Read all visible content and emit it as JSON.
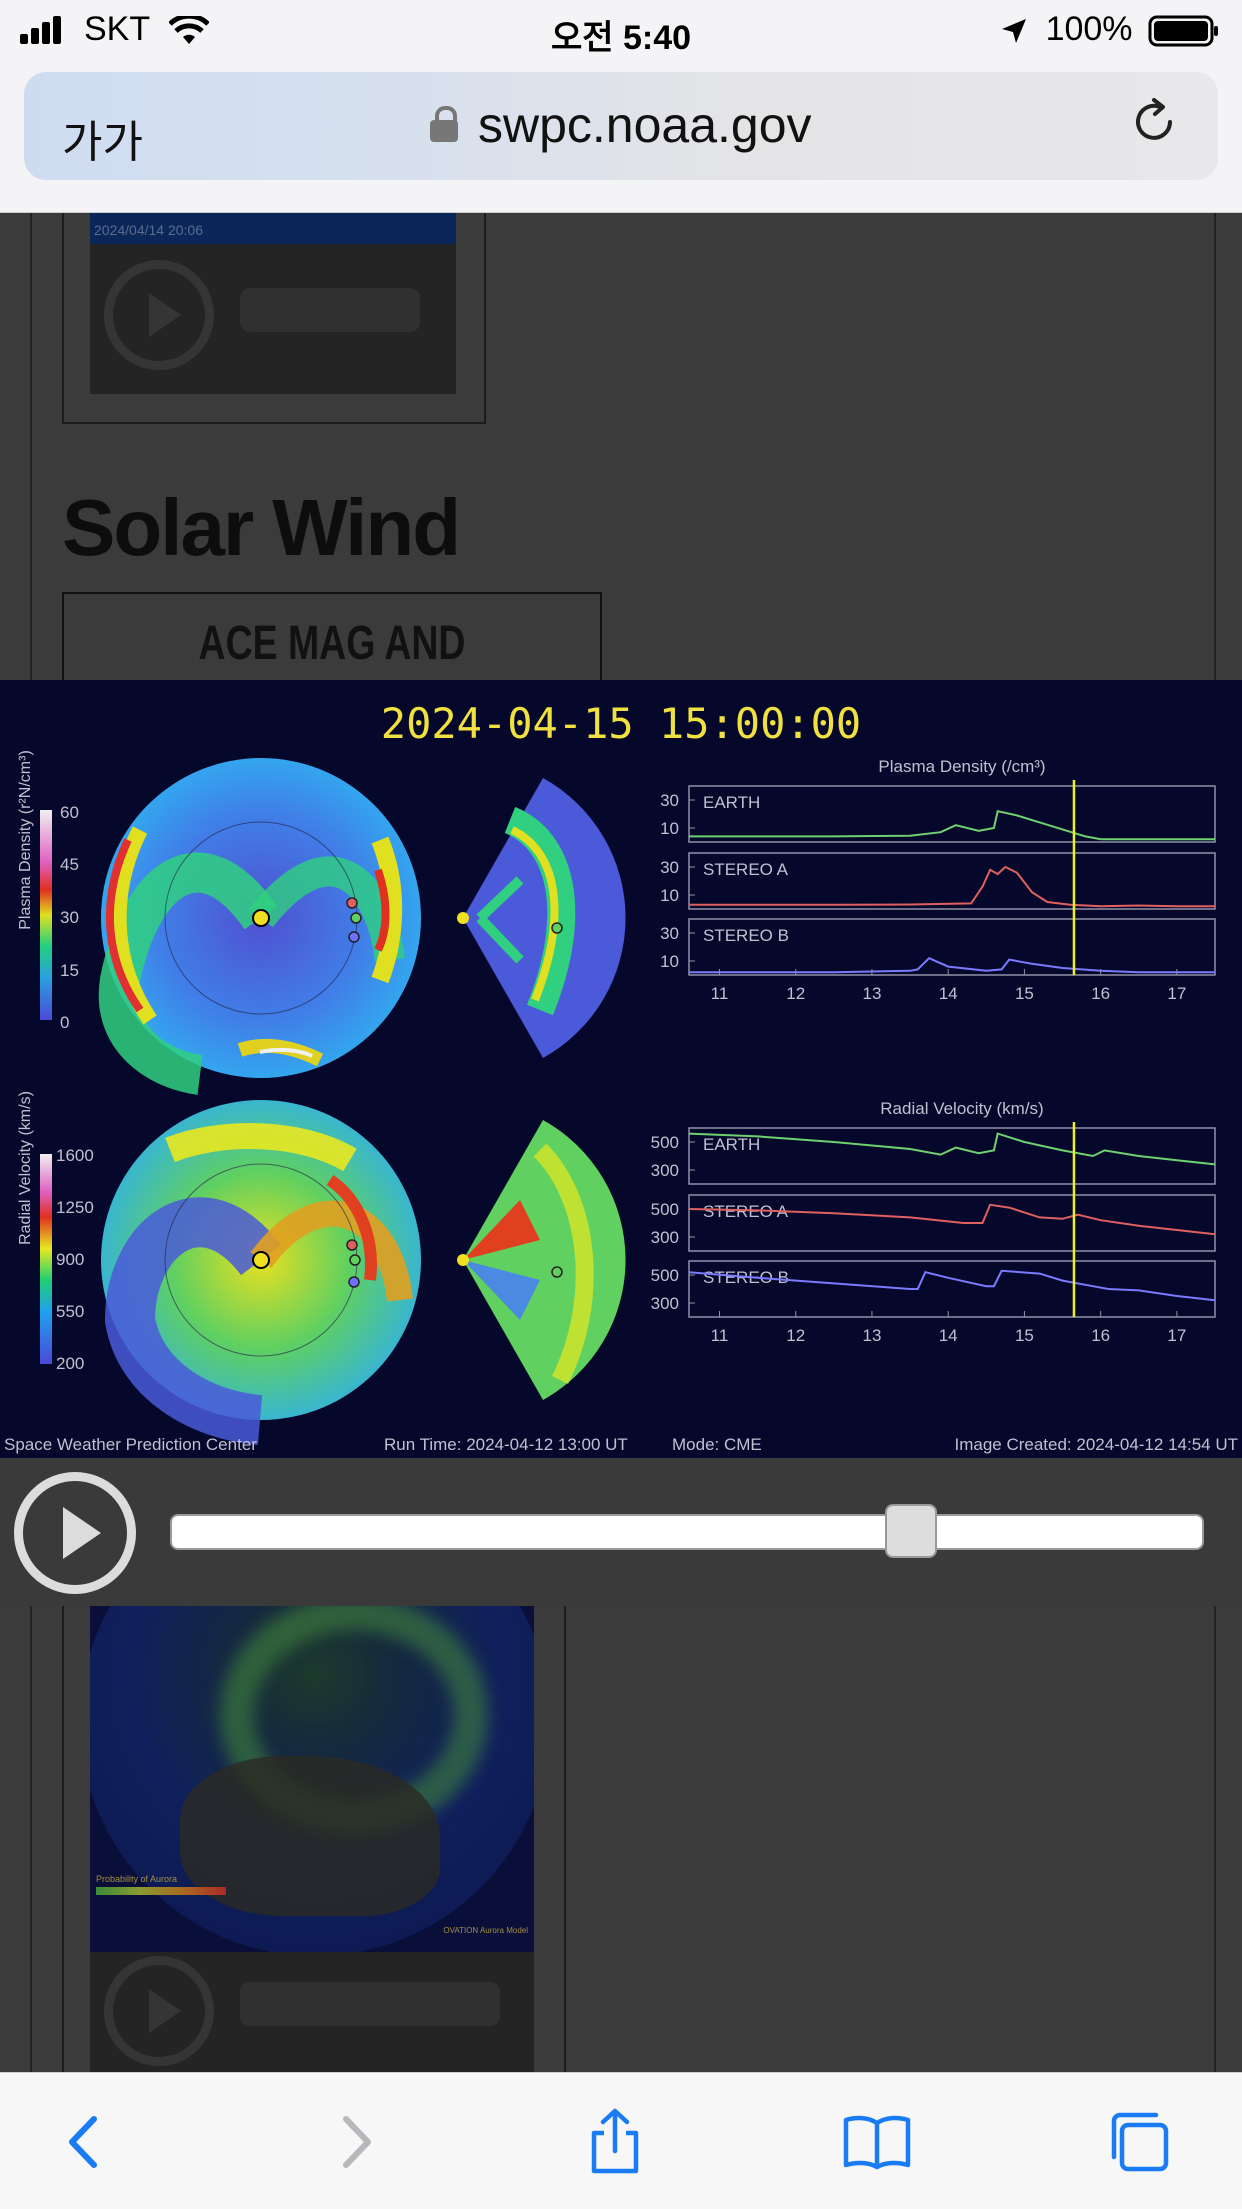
{
  "status_bar": {
    "carrier": "SKT",
    "time": "오전 5:40",
    "battery": "100%"
  },
  "address_bar": {
    "aa_label": "가가",
    "url": "swpc.noaa.gov"
  },
  "page": {
    "thumb_timestamp": "2024/04/14 20:06",
    "section_title": "Solar Wind",
    "section_button": "ACE MAG AND SWEPAM"
  },
  "aurora": {
    "legend_title": "Probability of Aurora",
    "model_note": "OVATION Aurora Model"
  },
  "video": {
    "frame_time": "2024-04-15 15:00:00",
    "footer_left": "Space Weather Prediction Center",
    "footer_runtime": "Run Time: 2024-04-12 13:00 UT",
    "footer_mode": "Mode: CME",
    "footer_created": "Image Created: 2024-04-12 14:54 UT",
    "density_axis_label": "Plasma Density (r²N/cm³)",
    "density_ticks": [
      "60",
      "45",
      "30",
      "15",
      "0"
    ],
    "velocity_axis_label": "Radial Velocity (km/s)",
    "velocity_ticks": [
      "1600",
      "1250",
      "900",
      "550",
      "200"
    ]
  },
  "player": {
    "slider_position": 0.728
  },
  "chart_data": [
    {
      "type": "line",
      "title": "Plasma Density (/cm³)",
      "x_ticks": [
        "11",
        "12",
        "13",
        "14",
        "15",
        "16",
        "17"
      ],
      "xlim": [
        10.6,
        17.5
      ],
      "current_time_marker": 15.65,
      "panels": [
        {
          "name": "EARTH",
          "color": "#6fd16f",
          "y_ticks": [
            "30",
            "10"
          ],
          "ylim": [
            0,
            40
          ],
          "x": [
            10.6,
            11.5,
            12.5,
            13.5,
            13.9,
            14.1,
            14.4,
            14.6,
            14.65,
            14.9,
            15.2,
            15.5,
            15.8,
            16.0,
            16.5,
            17.0,
            17.5
          ],
          "y": [
            4,
            4,
            4,
            4.5,
            7,
            12,
            8,
            10,
            22,
            19,
            14,
            9,
            4,
            2,
            2,
            2,
            2
          ]
        },
        {
          "name": "STEREO A",
          "color": "#e06060",
          "y_ticks": [
            "30",
            "10"
          ],
          "ylim": [
            0,
            40
          ],
          "x": [
            10.6,
            11.5,
            12.5,
            13.5,
            14.3,
            14.45,
            14.55,
            14.65,
            14.75,
            14.9,
            15.1,
            15.3,
            15.6,
            16.0,
            16.5,
            17.0,
            17.5
          ],
          "y": [
            3,
            3,
            3,
            3.2,
            4,
            16,
            28,
            25,
            30,
            26,
            12,
            5,
            3,
            2,
            2.5,
            2,
            2
          ]
        },
        {
          "name": "STEREO B",
          "color": "#7a7aff",
          "y_ticks": [
            "30",
            "10"
          ],
          "ylim": [
            0,
            40
          ],
          "x": [
            10.6,
            11.5,
            12.5,
            13.5,
            13.6,
            13.75,
            14.0,
            14.5,
            14.7,
            14.8,
            15.1,
            15.5,
            16.0,
            16.5,
            17.0,
            17.5
          ],
          "y": [
            2,
            2,
            2,
            3,
            4,
            12,
            6,
            3,
            4,
            11,
            8,
            5,
            3,
            2,
            2,
            2
          ]
        }
      ]
    },
    {
      "type": "line",
      "title": "Radial Velocity (km/s)",
      "x_ticks": [
        "11",
        "12",
        "13",
        "14",
        "15",
        "16",
        "17"
      ],
      "xlim": [
        10.6,
        17.5
      ],
      "current_time_marker": 15.65,
      "panels": [
        {
          "name": "EARTH",
          "color": "#6fd16f",
          "y_ticks": [
            "500",
            "300"
          ],
          "ylim": [
            200,
            600
          ],
          "x": [
            10.6,
            11.5,
            12.5,
            13.5,
            13.9,
            14.1,
            14.4,
            14.6,
            14.65,
            15.0,
            15.5,
            15.9,
            16.05,
            16.5,
            17.0,
            17.5
          ],
          "y": [
            560,
            540,
            500,
            450,
            410,
            460,
            420,
            440,
            560,
            500,
            440,
            400,
            440,
            400,
            370,
            340
          ]
        },
        {
          "name": "STEREO A",
          "color": "#e06060",
          "y_ticks": [
            "500",
            "300"
          ],
          "ylim": [
            200,
            600
          ],
          "x": [
            10.6,
            11.5,
            12.5,
            13.5,
            14.2,
            14.45,
            14.55,
            14.8,
            15.2,
            15.5,
            15.7,
            16.0,
            16.5,
            17.0,
            17.5
          ],
          "y": [
            500,
            490,
            470,
            440,
            400,
            400,
            530,
            510,
            440,
            430,
            460,
            420,
            380,
            350,
            320
          ]
        },
        {
          "name": "STEREO B",
          "color": "#7a7aff",
          "y_ticks": [
            "500",
            "300"
          ],
          "ylim": [
            200,
            600
          ],
          "x": [
            10.6,
            11.5,
            12.5,
            13.5,
            13.6,
            13.7,
            14.0,
            14.5,
            14.6,
            14.7,
            15.2,
            15.5,
            15.9,
            16.1,
            16.5,
            17.0,
            17.5
          ],
          "y": [
            520,
            480,
            440,
            400,
            400,
            520,
            480,
            420,
            420,
            530,
            510,
            460,
            420,
            400,
            390,
            350,
            320
          ]
        }
      ]
    }
  ]
}
